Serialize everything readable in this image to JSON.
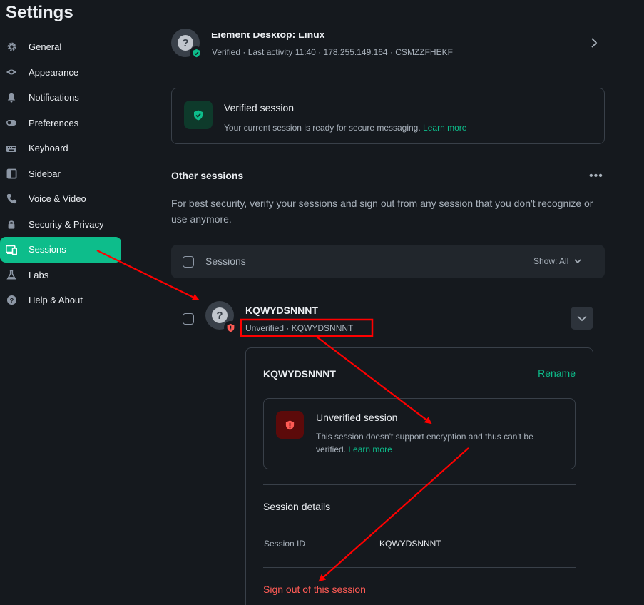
{
  "sidebar": {
    "title": "Settings",
    "items": [
      {
        "label": "General",
        "icon": "gear-icon"
      },
      {
        "label": "Appearance",
        "icon": "eye-icon"
      },
      {
        "label": "Notifications",
        "icon": "bell-icon"
      },
      {
        "label": "Preferences",
        "icon": "toggle-icon"
      },
      {
        "label": "Keyboard",
        "icon": "keyboard-icon"
      },
      {
        "label": "Sidebar",
        "icon": "sidebar-icon"
      },
      {
        "label": "Voice & Video",
        "icon": "phone-icon"
      },
      {
        "label": "Security & Privacy",
        "icon": "lock-icon"
      },
      {
        "label": "Sessions",
        "icon": "devices-icon",
        "active": true
      },
      {
        "label": "Labs",
        "icon": "flask-icon"
      },
      {
        "label": "Help & About",
        "icon": "help-icon"
      }
    ]
  },
  "current_session": {
    "name": "Element Desktop: Linux",
    "meta": "Verified · Last activity 11:40 · 178.255.149.164 · CSMZZFHEKF",
    "verified_card": {
      "title": "Verified session",
      "desc": "Your current session is ready for secure messaging.",
      "link": "Learn more"
    }
  },
  "other_sessions": {
    "title": "Other sessions",
    "desc": "For best security, verify your sessions and sign out from any session that you don't recognize or use anymore.",
    "filter": {
      "label": "Sessions",
      "show": "Show: All"
    },
    "session": {
      "name": "KQWYDSNNNT",
      "meta": "Unverified · KQWYDSNNNT",
      "details": {
        "name": "KQWYDSNNNT",
        "rename": "Rename",
        "unverified_card": {
          "title": "Unverified session",
          "desc": "This session doesn't support encryption and thus can't be verified.",
          "link": "Learn more"
        },
        "section_title": "Session details",
        "session_id_label": "Session ID",
        "session_id_value": "KQWYDSNNNT",
        "signout": "Sign out of this session"
      }
    }
  },
  "colors": {
    "accent": "#0dbd8b",
    "danger": "#ff5b55",
    "annotation": "#ff0000",
    "background": "#15191e"
  }
}
